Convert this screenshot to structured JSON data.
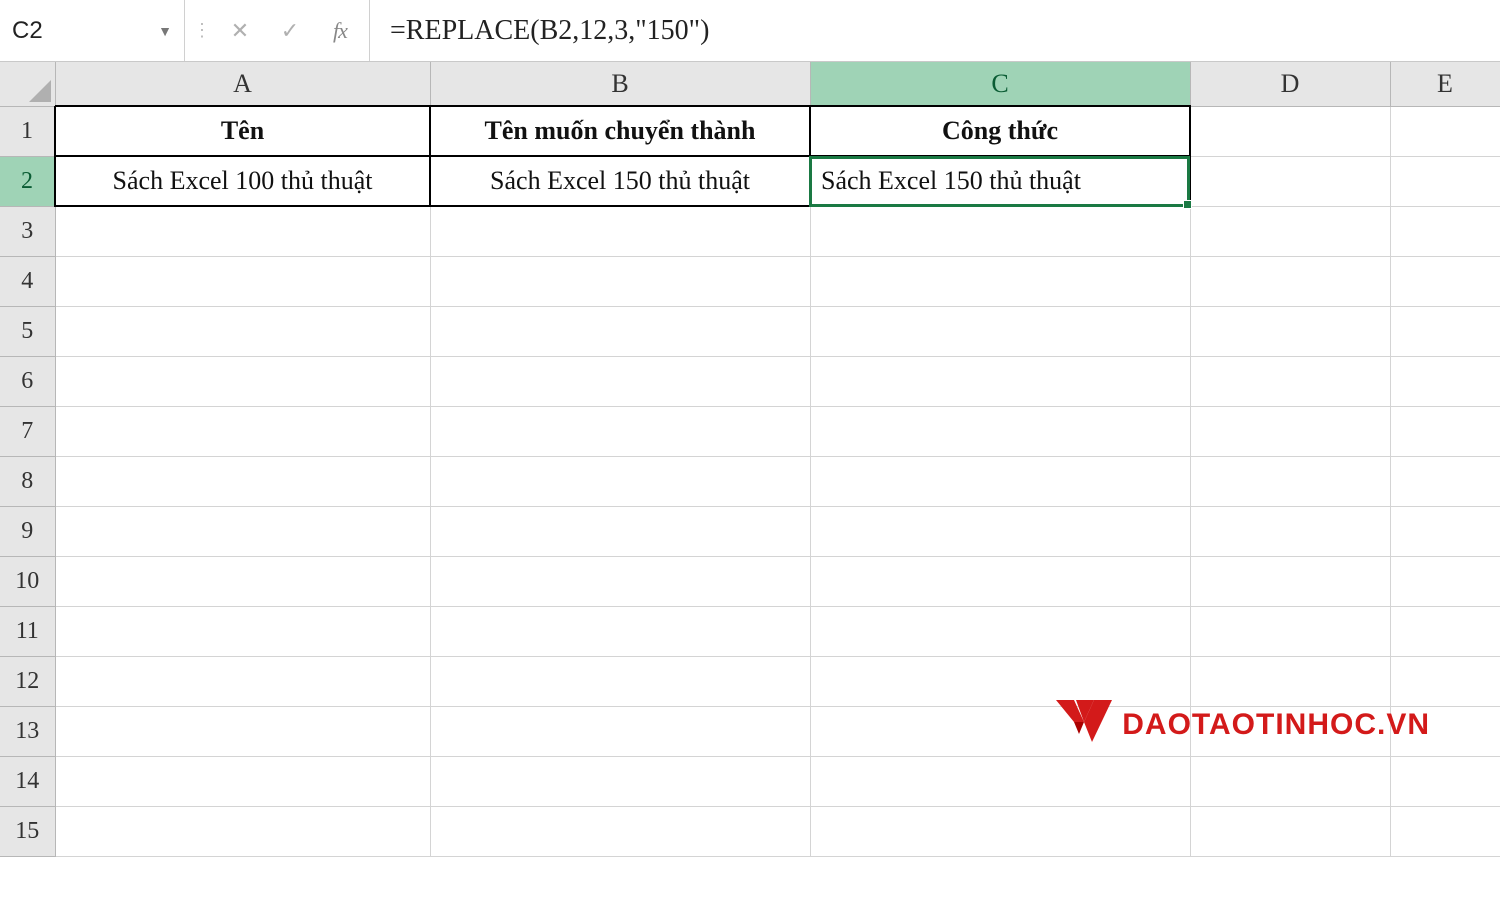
{
  "formula_bar": {
    "name_box": "C2",
    "cancel_icon": "✕",
    "enter_icon": "✓",
    "fx_label": "fx",
    "formula": "=REPLACE(B2,12,3,\"150\")"
  },
  "columns": [
    "A",
    "B",
    "C",
    "D",
    "E"
  ],
  "highlighted_column_index": 2,
  "row_headers": [
    "1",
    "2",
    "3",
    "4",
    "5",
    "6",
    "7",
    "8",
    "9",
    "10",
    "11",
    "12",
    "13",
    "14",
    "15"
  ],
  "highlighted_row_index": 1,
  "table": {
    "headers": {
      "A": "Tên",
      "B": "Tên muốn chuyển thành",
      "C": "Công thức"
    },
    "row2": {
      "A": "Sách Excel 100 thủ thuật",
      "B": "Sách Excel 150 thủ thuật",
      "C": "Sách Excel 150 thủ thuật"
    }
  },
  "active_cell": "C2",
  "watermark": {
    "text": "DAOTAOTINHOC.VN",
    "color": "#d31a1a"
  }
}
